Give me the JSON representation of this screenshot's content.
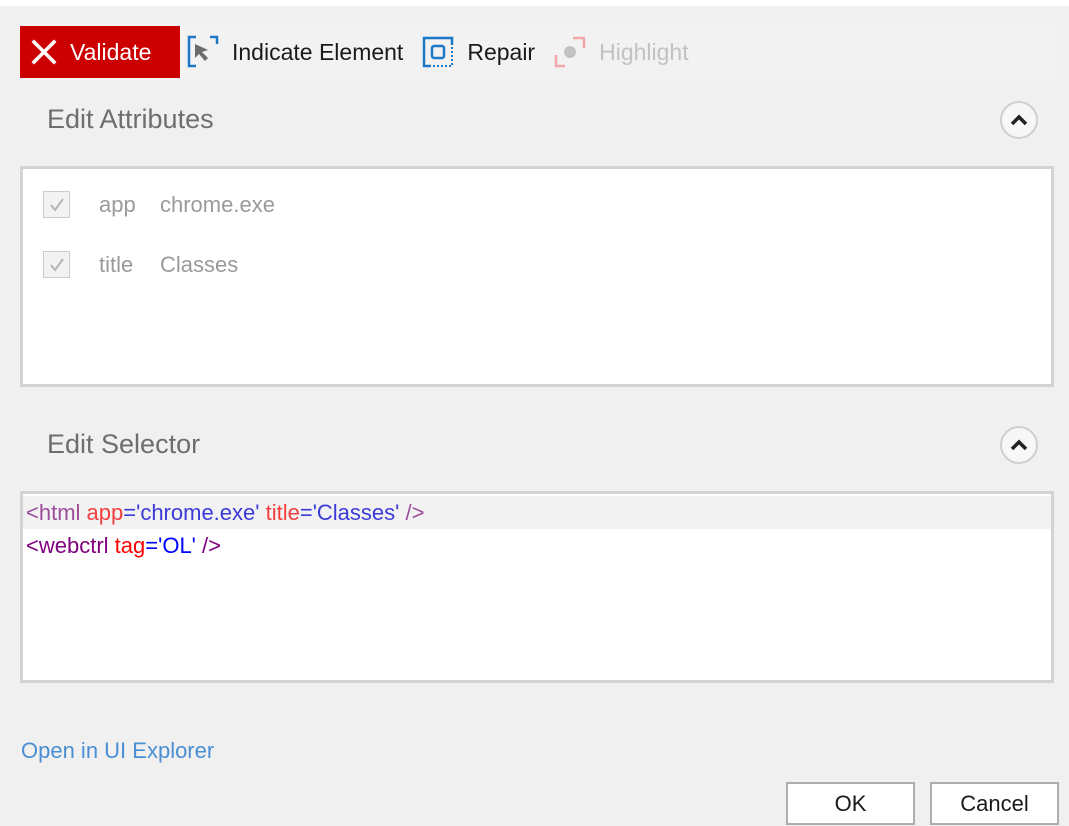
{
  "toolbar": {
    "validate_label": "Validate",
    "indicate_label": "Indicate Element",
    "repair_label": "Repair",
    "highlight_label": "Highlight",
    "validate_color": "#cc0000"
  },
  "attributes_section": {
    "title": "Edit Attributes",
    "rows": [
      {
        "checked": true,
        "key": "app",
        "value": "chrome.exe"
      },
      {
        "checked": true,
        "key": "title",
        "value": "Classes"
      }
    ]
  },
  "selector_section": {
    "title": "Edit Selector",
    "lines": [
      {
        "highlighted": true,
        "tag_open": "<html",
        "attrs": [
          {
            "name": "app",
            "value": "'chrome.exe'"
          },
          {
            "name": "title",
            "value": "'Classes'"
          }
        ],
        "tag_close": " />"
      },
      {
        "highlighted": false,
        "tag_open": "<webctrl",
        "attrs": [
          {
            "name": "tag",
            "value": "'OL'"
          }
        ],
        "tag_close": " />"
      }
    ]
  },
  "footer": {
    "explorer_link": "Open in UI Explorer",
    "ok_label": "OK",
    "cancel_label": "Cancel"
  }
}
